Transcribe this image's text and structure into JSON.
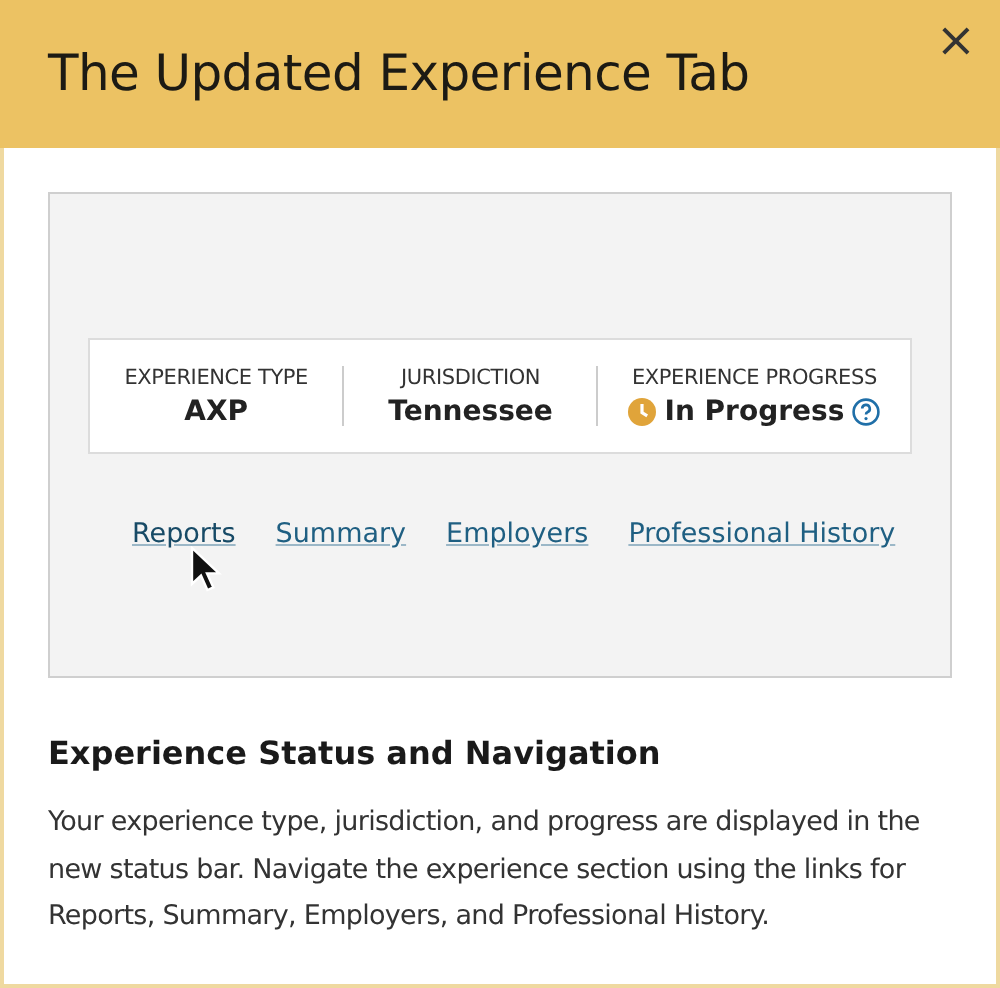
{
  "dialog": {
    "title": "The Updated Experience Tab",
    "close": "×"
  },
  "status_bar": [
    {
      "kind": "plain",
      "label": "EXPERIENCE TYPE",
      "value": "AXP"
    },
    {
      "kind": "plain",
      "label": "JURISDICTION",
      "value": "Tennessee"
    },
    {
      "kind": "progress",
      "label": "EXPERIENCE PROGRESS",
      "value": "In Progress"
    }
  ],
  "links": [
    {
      "label": "Reports",
      "hovered": true
    },
    {
      "label": "Summary",
      "hovered": false
    },
    {
      "label": "Employers",
      "hovered": false
    },
    {
      "label": "Professional History",
      "hovered": false
    }
  ],
  "section": {
    "heading": "Experience Status and Navigation",
    "text": "Your experience type, jurisdiction, and progress are displayed in the new status bar. Navigate the experience section using the links for Reports, Summary, Employers, and Professional History."
  }
}
